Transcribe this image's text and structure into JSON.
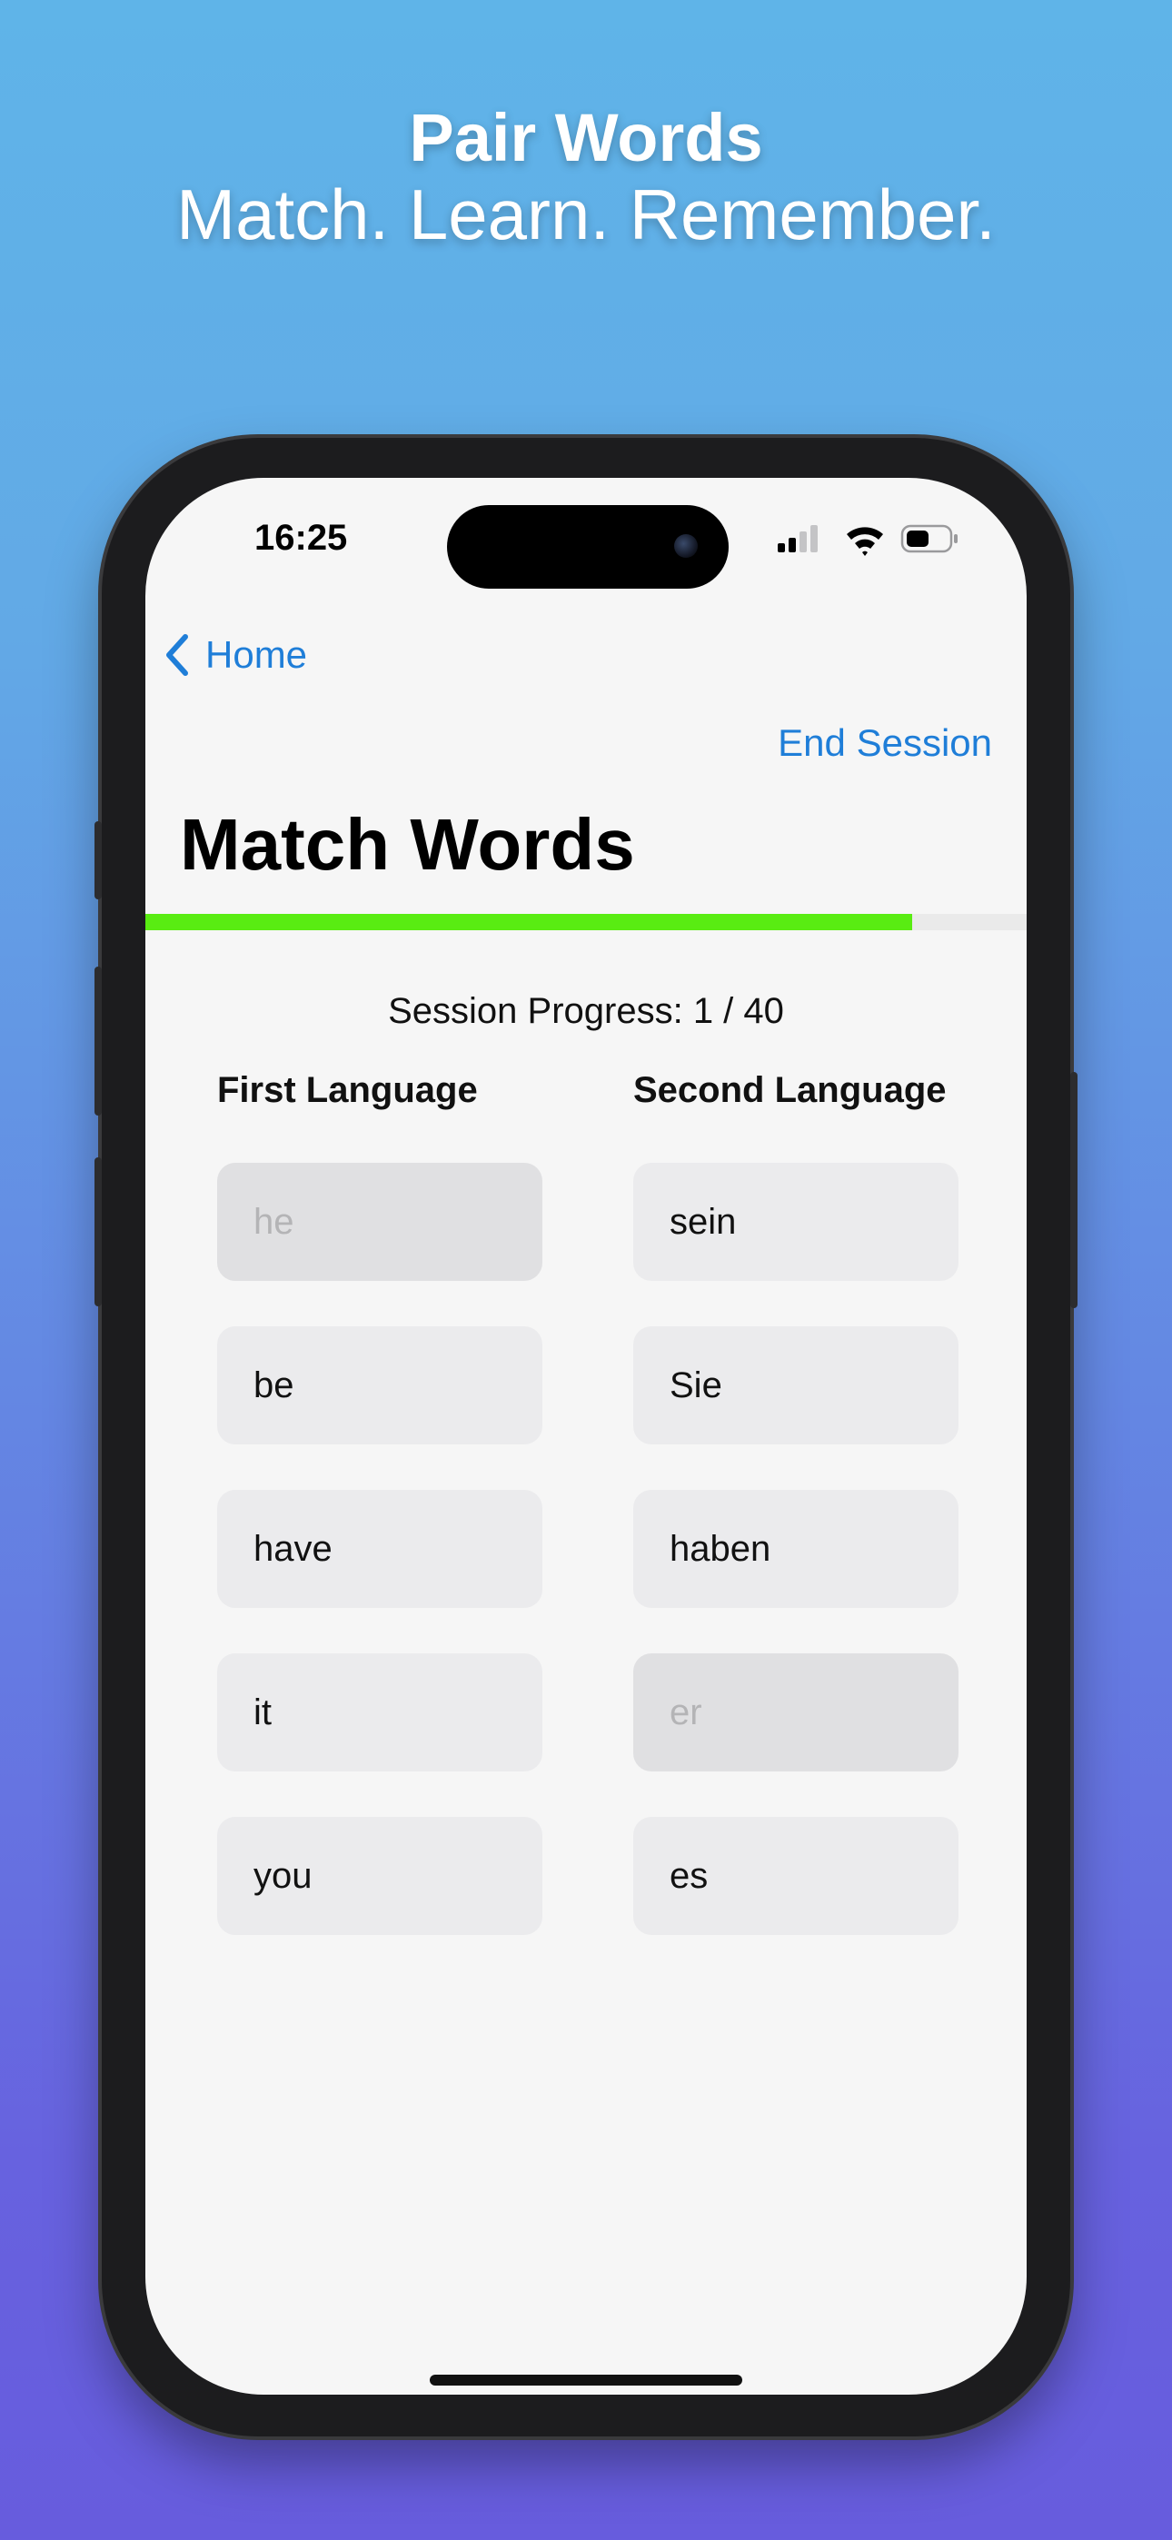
{
  "promo": {
    "title": "Pair Words",
    "subtitle": "Match. Learn. Remember."
  },
  "status_bar": {
    "time": "16:25",
    "icons": [
      "signal-icon",
      "wifi-icon",
      "battery-icon"
    ]
  },
  "nav": {
    "back_label": "Home",
    "end_session_label": "End Session"
  },
  "page": {
    "title": "Match Words"
  },
  "progress": {
    "fraction": 0.87,
    "label": "Session Progress: 1 / 40"
  },
  "columns": {
    "first_header": "First Language",
    "second_header": "Second Language"
  },
  "first_words": [
    {
      "text": "he",
      "matched": true
    },
    {
      "text": "be",
      "matched": false
    },
    {
      "text": "have",
      "matched": false
    },
    {
      "text": "it",
      "matched": false
    },
    {
      "text": "you",
      "matched": false
    }
  ],
  "second_words": [
    {
      "text": "sein",
      "matched": false
    },
    {
      "text": "Sie",
      "matched": false
    },
    {
      "text": "haben",
      "matched": false
    },
    {
      "text": "er",
      "matched": true
    },
    {
      "text": "es",
      "matched": false
    }
  ],
  "colors": {
    "accent": "#1f7ed8",
    "progress": "#59ec12",
    "tile": "#ebebed",
    "tile_matched": "#e0e0e2",
    "matched_text": "#b4b4b6"
  }
}
